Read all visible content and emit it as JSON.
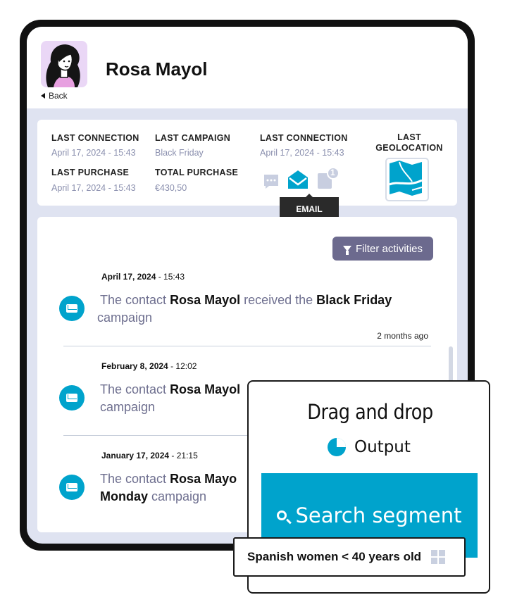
{
  "profile": {
    "name": "Rosa Mayol",
    "back_label": "Back"
  },
  "summary": {
    "last_connection_label": "LAST CONNECTION",
    "last_connection_value": "April 17, 2024 - 15:43",
    "last_campaign_label": "LAST CAMPAIGN",
    "last_campaign_value": "Black Friday",
    "last_connection2_label": "LAST CONNECTION",
    "last_connection2_value": "April 17, 2024 - 15:43",
    "last_purchase_label": "LAST PURCHASE",
    "last_purchase_value": "April 17, 2024 - 15:43",
    "total_purchase_label": "TOTAL PURCHASE",
    "total_purchase_value": "€430,50",
    "geolocation_label_1": "LAST",
    "geolocation_label_2": "GEOLOCATION",
    "channel_tooltip": "EMAIL",
    "notification_count": "1"
  },
  "activities": {
    "filter_label": "Filter activities",
    "items": [
      {
        "date": "April 17, 2024",
        "time": " - 15:43",
        "pre": "The contact ",
        "name": "Rosa Mayol",
        "mid": " received the ",
        "campaign": "Black Friday",
        "post": " campaign",
        "ago": "2 months ago"
      },
      {
        "date": "February 8, 2024",
        "time": " - 12:02",
        "pre": "The contact ",
        "name": "Rosa Mayol",
        "mid": "",
        "campaign": "",
        "post": "campaign",
        "ago": ""
      },
      {
        "date": "January 17, 2024",
        "time": " - 21:15",
        "pre": "The contact ",
        "name": "Rosa Mayo",
        "mid": "",
        "campaign": "Monday",
        "post": " campaign",
        "ago": ""
      }
    ]
  },
  "widget": {
    "title": "Drag and drop",
    "output_label": "Output",
    "search_label": "Search segment",
    "segment_chip": "Spanish women < 40 years old"
  },
  "colors": {
    "accent": "#00a3cc",
    "filter_button": "#6c6a8e",
    "muted_text": "#8a8fae"
  }
}
